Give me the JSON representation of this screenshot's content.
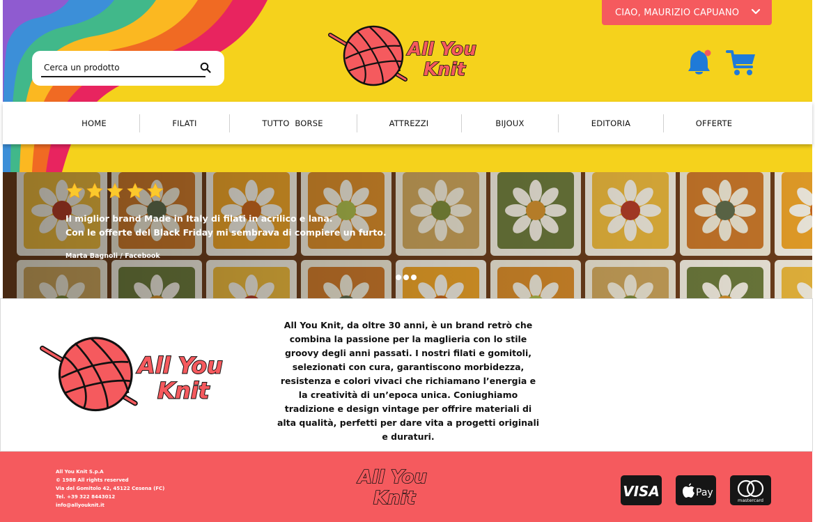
{
  "header": {
    "search_placeholder": "Cerca un prodotto",
    "logo_text_line1": "All You",
    "logo_text_line2": "Knit",
    "user_menu_label": "CIAO, MAURIZIO CAPUANO",
    "notification_dot": true
  },
  "nav": {
    "items": [
      {
        "label": "HOME"
      },
      {
        "label": "FILATI"
      },
      {
        "label": "TUTTO  BORSE"
      },
      {
        "label": "ATTREZZI"
      },
      {
        "label": "BIJOUX"
      },
      {
        "label": "EDITORIA"
      },
      {
        "label": "OFFERTE"
      }
    ]
  },
  "hero": {
    "rating": 5,
    "rating_max": 5,
    "quote_line1": "Il miglior brand Made in Italy di filati in acrilico e lana.",
    "quote_line2": "Con le offerte del Black Friday mi sembrava di compiere un furto.",
    "author": "Marta Bagnoli / Facebook",
    "slides": 3
  },
  "about": {
    "text": "All You Knit, da oltre 30 anni, è un brand retrò che combina la passione per la maglieria con lo stile groovy degli anni passati. I nostri filati e gomitoli, selezionati con cura, garantiscono morbidezza, resistenza e colori vivaci che richiamano l’energia e la creatività di un’epoca unica. Coniughiamo tradizione e design vintage per offrire materiali di alta qualità, perfetti per dare vita a progetti originali e duraturi."
  },
  "footer": {
    "company": "All You Knit S.p.A",
    "rights": "© 1988 All rights reserved",
    "address": "Via del Gomitolo 42, 45122 Cesena (FC)",
    "phone": "Tel. +39 322 8443012",
    "email": "info@allyouknit.it",
    "payments": [
      "VISA",
      "Pay",
      "mastercard"
    ]
  },
  "colors": {
    "yellow": "#f5d21c",
    "coral": "#f55a5e",
    "accent_blue": "#1f7ad8",
    "nav_bg": "#ffffff"
  },
  "icons": [
    "search-icon",
    "chevron-down-icon",
    "bell-icon",
    "cart-icon",
    "star-icon"
  ]
}
